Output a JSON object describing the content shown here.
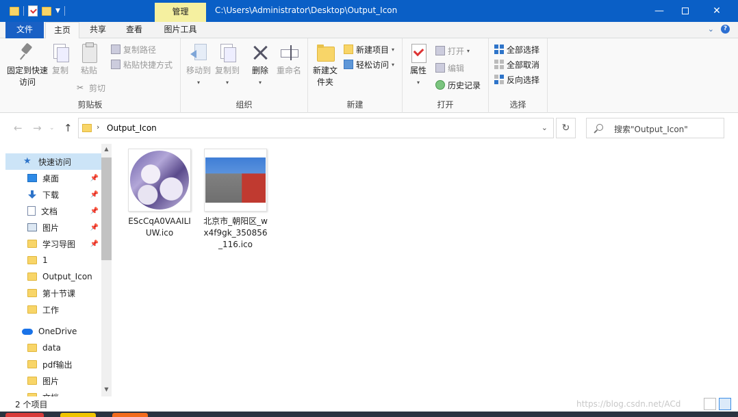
{
  "titlebar": {
    "context_tab": "管理",
    "path_title": "C:\\Users\\Administrator\\Desktop\\Output_Icon",
    "minimize": "—",
    "close": "✕"
  },
  "tabs": {
    "file": "文件",
    "home": "主页",
    "share": "共享",
    "view": "查看",
    "picture_tools": "图片工具"
  },
  "ribbon": {
    "clipboard": {
      "label": "剪贴板",
      "pin_quick": "固定到快速访问",
      "copy": "复制",
      "paste": "粘贴",
      "copy_path": "复制路径",
      "paste_shortcut": "粘贴快捷方式",
      "cut": "剪切"
    },
    "organize": {
      "label": "组织",
      "move_to": "移动到",
      "copy_to": "复制到",
      "delete": "删除",
      "rename": "重命名"
    },
    "new": {
      "label": "新建",
      "new_folder": "新建文件夹",
      "new_item": "新建项目",
      "easy_access": "轻松访问"
    },
    "open": {
      "label": "打开",
      "properties": "属性",
      "open": "打开",
      "edit": "编辑",
      "history": "历史记录"
    },
    "select": {
      "label": "选择",
      "select_all": "全部选择",
      "select_none": "全部取消",
      "invert": "反向选择"
    }
  },
  "address": {
    "current": "Output_Icon",
    "search_placeholder": "搜索\"Output_Icon\""
  },
  "sidebar": {
    "quick_access": "快速访问",
    "items": [
      {
        "label": "桌面",
        "icon": "desktop-icon",
        "pinned": true
      },
      {
        "label": "下载",
        "icon": "download-icon",
        "pinned": true
      },
      {
        "label": "文档",
        "icon": "document-icon",
        "pinned": true
      },
      {
        "label": "图片",
        "icon": "pictures-icon",
        "pinned": true
      },
      {
        "label": "学习导图",
        "icon": "folder-icon",
        "pinned": true
      },
      {
        "label": "1",
        "icon": "folder-icon",
        "pinned": false
      },
      {
        "label": "Output_Icon",
        "icon": "folder-icon",
        "pinned": false
      },
      {
        "label": "第十节课",
        "icon": "folder-icon",
        "pinned": false
      },
      {
        "label": "工作",
        "icon": "folder-icon",
        "pinned": false
      }
    ],
    "onedrive": "OneDrive",
    "onedrive_items": [
      {
        "label": "data"
      },
      {
        "label": "pdf输出"
      },
      {
        "label": "图片"
      },
      {
        "label": "文档"
      }
    ]
  },
  "files": [
    {
      "name": "EScCqA0VAAILIUW.ico",
      "thumb": "anime-circle-thumbnail"
    },
    {
      "name": "北京市_朝阳区_wx4f9gk_350856_116.ico",
      "thumb": "street-photo-thumbnail"
    }
  ],
  "status": {
    "count": "2 个项目",
    "watermark": "https://blog.csdn.net/ACd"
  },
  "colors": {
    "titlebar": "#0a5fc6",
    "file_tab": "#1960c4",
    "context_tab": "#f5f0a0",
    "selection": "#cce4f7",
    "folder": "#f8d568"
  }
}
